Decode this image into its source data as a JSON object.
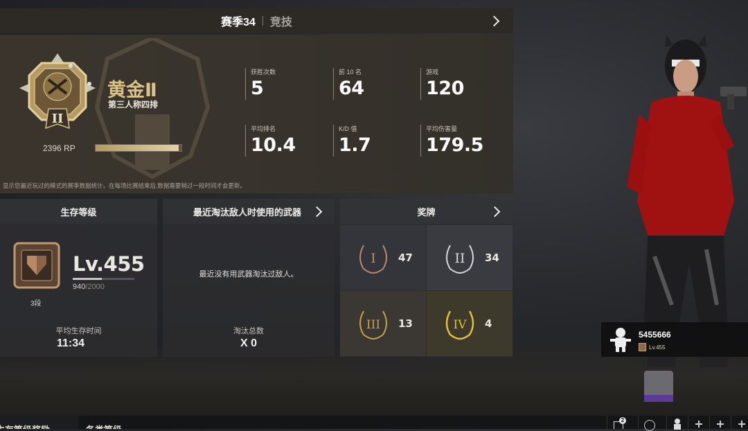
{
  "season_bar": {
    "season": "赛季34",
    "mode": "竞技"
  },
  "rank": {
    "tier_name": "黄金Ⅱ",
    "tier_numeral": "II",
    "mode": "第三人称四排",
    "rp_text": "2396 RP",
    "rp_progress": 0.97,
    "note": "显示您最近玩过的模式的赛季数据统计。在每场比赛结束后,数据需要稍过一段时间才会更新。",
    "stats": [
      {
        "label": "获胜次数",
        "value": "5"
      },
      {
        "label": "前 10 名",
        "value": "64"
      },
      {
        "label": "游戏",
        "value": "120"
      },
      {
        "label": "平均排名",
        "value": "10.4"
      },
      {
        "label": "K/D 值",
        "value": "1.7"
      },
      {
        "label": "平均伤害量",
        "value": "179.5"
      }
    ]
  },
  "survival": {
    "title": "生存等级",
    "level": "Lv.455",
    "xp_current": "940",
    "xp_max": "/2000",
    "xp_progress": 0.47,
    "tier": "3段",
    "avg_label": "平均生存时间",
    "avg_value": "11:34"
  },
  "weapon": {
    "title": "最近淘汰敌人时使用的武器",
    "empty": "最近没有用武器淘汰过敌人。",
    "kills_label": "淘汰总数",
    "kills_value": "X 0"
  },
  "medals": {
    "title": "奖牌",
    "items": [
      {
        "numeral": "I",
        "count": "47",
        "color": "#b98a6e"
      },
      {
        "numeral": "II",
        "count": "34",
        "color": "#d9d9d9"
      },
      {
        "numeral": "III",
        "count": "13",
        "color": "#c9a24a"
      },
      {
        "numeral": "IV",
        "count": "4",
        "color": "#e1c13a"
      }
    ]
  },
  "player": {
    "name": "5455666",
    "level": "Lv.455"
  },
  "bottom_nav": {
    "tab1": "生存等级奖励",
    "tab2": "各类等级",
    "mail_count": "2"
  }
}
